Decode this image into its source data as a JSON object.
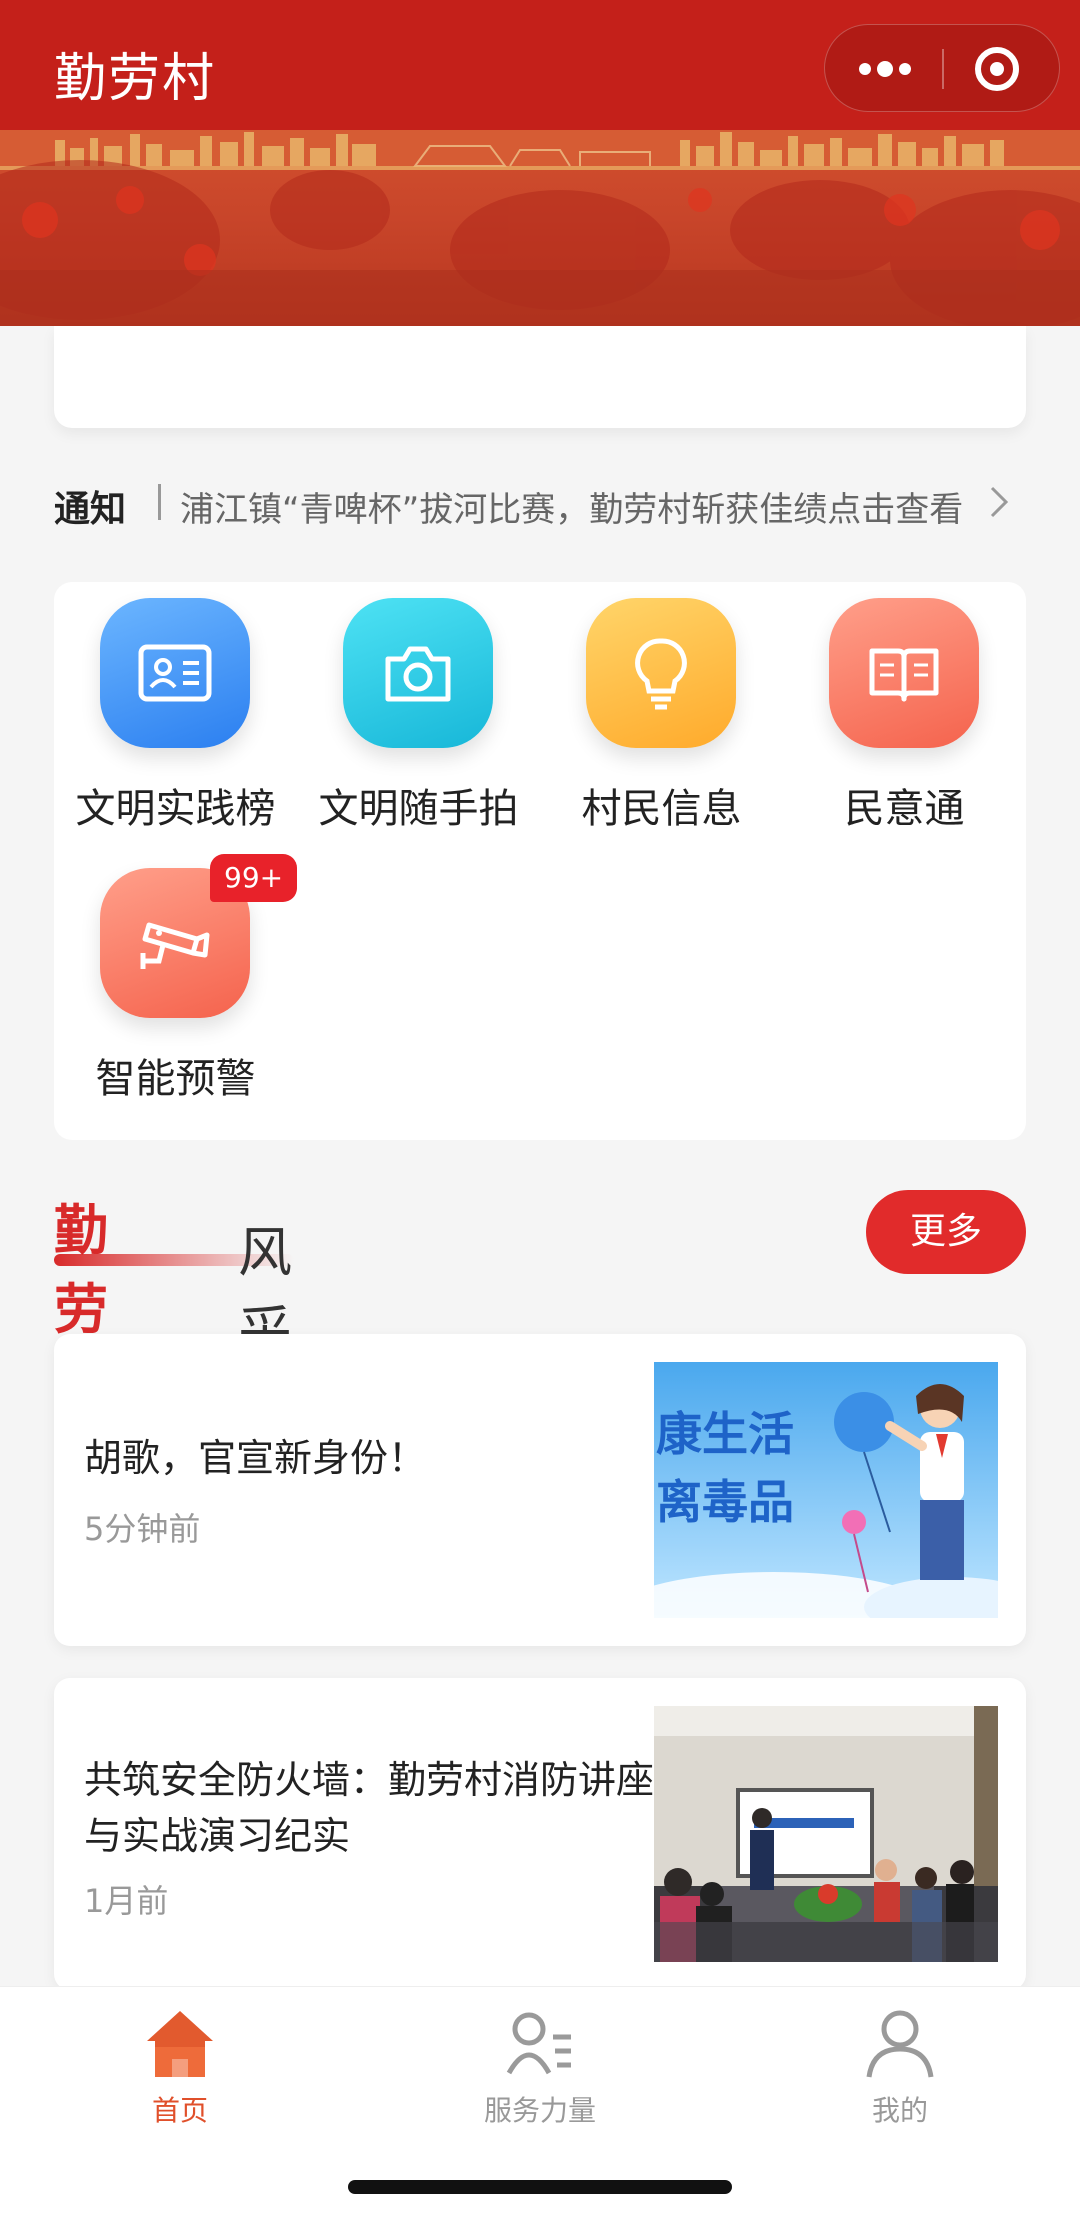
{
  "app": {
    "title": "勤劳村",
    "colors": {
      "primary": "#c4201a",
      "accent": "#e12b2b",
      "tab_active": "#e0502b",
      "tab_inactive": "#999999"
    }
  },
  "header": {
    "more_icon": "more-dots-icon",
    "close_icon": "capsule-close-icon"
  },
  "notice": {
    "label": "通知",
    "text": "浦江镇“青啤杯”拔河比赛，勤劳村斩获佳绩",
    "action": "点击查看"
  },
  "functions": [
    {
      "label": "文明实践榜",
      "icon": "id-card-icon"
    },
    {
      "label": "文明随手拍",
      "icon": "camera-icon"
    },
    {
      "label": "村民信息",
      "icon": "lightbulb-icon"
    },
    {
      "label": "民意通",
      "icon": "book-icon"
    },
    {
      "label": "智能预警",
      "icon": "cctv-camera-icon",
      "badge": "99+"
    }
  ],
  "section": {
    "title_red": "勤劳村",
    "title_dark": "风采",
    "more": "更多"
  },
  "news": [
    {
      "title": "胡歌，官宣新身份！",
      "time": "5分钟前",
      "thumb_text_line1": "康生活",
      "thumb_text_line2": "离毒品"
    },
    {
      "title": "共筑安全防火墙：勤劳村消防讲座与实战演习纪实",
      "time": "1月前"
    }
  ],
  "tabs": [
    {
      "label": "首页",
      "icon": "home-icon",
      "active": true
    },
    {
      "label": "服务力量",
      "icon": "person-list-icon",
      "active": false
    },
    {
      "label": "我的",
      "icon": "user-icon",
      "active": false
    }
  ]
}
